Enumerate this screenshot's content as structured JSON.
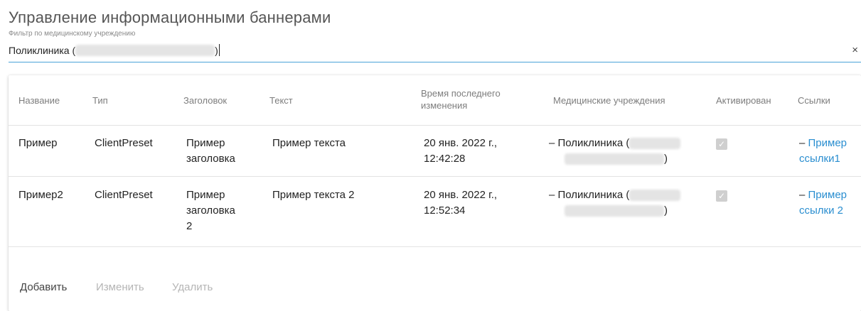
{
  "page": {
    "title": "Управление информационными баннерами"
  },
  "filter": {
    "label": "Фильтр по медицинскому учреждению",
    "value_prefix": "Поликлиника (",
    "value_suffix": ")",
    "clear_icon": "×"
  },
  "table": {
    "headers": {
      "name": "Название",
      "type": "Тип",
      "heading": "Заголовок",
      "text": "Текст",
      "time": "Время последнего изменения",
      "orgs": "Медицинские учреждения",
      "active": "Активирован",
      "links": "Ссылки"
    },
    "rows": [
      {
        "name": "Пример",
        "type": "ClientPreset",
        "heading": "Пример заголовка",
        "text": "Пример текста",
        "time": "20 янв. 2022 г., 12:42:28",
        "org_prefix": "– Поликлиника (",
        "org_suffix": ")",
        "active": true,
        "link_dash": "– ",
        "link": "Пример ссылки1"
      },
      {
        "name": "Пример2",
        "type": "ClientPreset",
        "heading": "Пример заголовка 2",
        "text": "Пример текста 2",
        "time": "20 янв. 2022 г., 12:52:34",
        "org_prefix": "– Поликлиника (",
        "org_suffix": ")",
        "active": true,
        "link_dash": "– ",
        "link": "Пример ссылки 2"
      }
    ]
  },
  "footer": {
    "add": "Добавить",
    "edit": "Изменить",
    "delete": "Удалить"
  },
  "colors": {
    "accent": "#4aa3d8",
    "link": "#2a8ed0",
    "disabled_text": "#b5b5b5"
  },
  "icons": {
    "clear": "close-icon",
    "checkbox": "check-icon"
  }
}
